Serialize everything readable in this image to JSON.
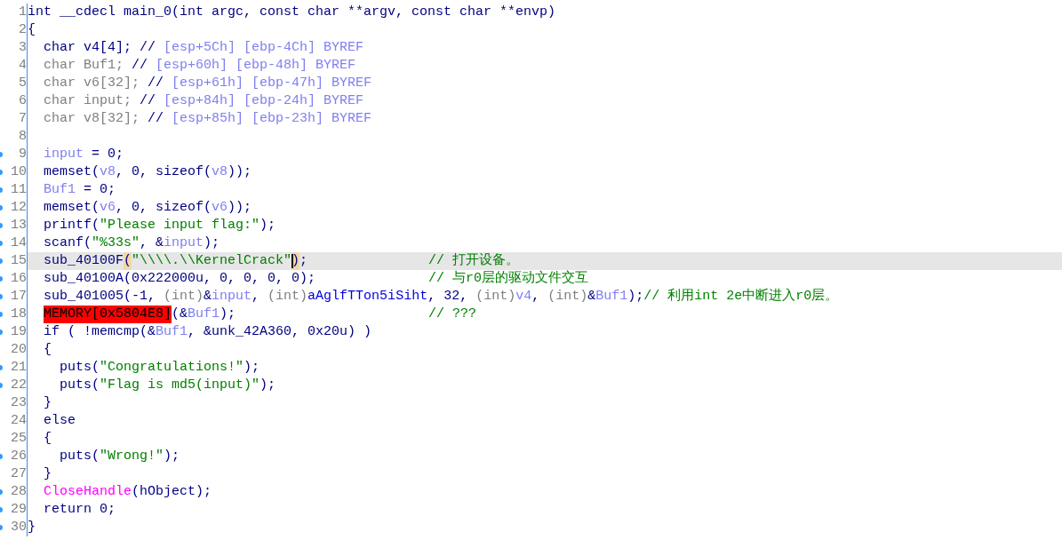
{
  "lines": [
    {
      "number": "1",
      "dot": false,
      "selected": false,
      "tokens": [
        {
          "text": "int __cdecl main_0(int argc, const char **argv, const char **envp)",
          "kind": "plain"
        }
      ]
    },
    {
      "number": "2",
      "dot": false,
      "selected": false,
      "tokens": [
        {
          "text": "{",
          "kind": "plain"
        }
      ],
      "children": [
        {
          "number": "3",
          "dot": false,
          "selected": false,
          "tokens": [
            {
              "text": "char v4[4]; //",
              "kind": "plain"
            },
            {
              "text": " [esp+5Ch] [ebp-4Ch] BYREF",
              "kind": "var"
            }
          ]
        },
        {
          "number": "4",
          "dot": false,
          "selected": false,
          "tokens": [
            {
              "text": "char Buf1;",
              "kind": "grey"
            },
            {
              "text": " //",
              "kind": "plain"
            },
            {
              "text": " [esp+60h] [ebp-48h] BYREF",
              "kind": "var"
            }
          ]
        },
        {
          "number": "5",
          "dot": false,
          "selected": false,
          "tokens": [
            {
              "text": "char v6[32];",
              "kind": "grey"
            },
            {
              "text": " //",
              "kind": "plain"
            },
            {
              "text": " [esp+61h] [ebp-47h] BYREF",
              "kind": "var"
            }
          ]
        },
        {
          "number": "6",
          "dot": false,
          "selected": false,
          "tokens": [
            {
              "text": "char input;",
              "kind": "grey"
            },
            {
              "text": " //",
              "kind": "plain"
            },
            {
              "text": " [esp+84h] [ebp-24h] BYREF",
              "kind": "var"
            }
          ]
        },
        {
          "number": "7",
          "dot": false,
          "selected": false,
          "tokens": [
            {
              "text": "char v8[32];",
              "kind": "grey"
            },
            {
              "text": " //",
              "kind": "plain"
            },
            {
              "text": " [esp+85h] [ebp-23h] BYREF",
              "kind": "var"
            }
          ]
        },
        {
          "number": "8",
          "dot": false,
          "selected": false
        },
        {
          "number": "9",
          "dot": true,
          "selected": false,
          "tokens": [
            {
              "text": "input",
              "kind": "var"
            },
            {
              "text": " = 0;",
              "kind": "plain"
            }
          ]
        },
        {
          "number": "10",
          "dot": true,
          "selected": false,
          "tokens": [
            {
              "text": "memset(",
              "kind": "plain"
            },
            {
              "text": "v8",
              "kind": "var"
            },
            {
              "text": ", 0, sizeof(",
              "kind": "plain"
            },
            {
              "text": "v8",
              "kind": "var"
            },
            {
              "text": "));",
              "kind": "plain"
            }
          ]
        },
        {
          "number": "11",
          "dot": true,
          "selected": false,
          "tokens": [
            {
              "text": "Buf1",
              "kind": "var"
            },
            {
              "text": " = 0;",
              "kind": "plain"
            }
          ]
        },
        {
          "number": "12",
          "dot": true,
          "selected": false,
          "tokens": [
            {
              "text": "memset(",
              "kind": "plain"
            },
            {
              "text": "v6",
              "kind": "var"
            },
            {
              "text": ", 0, sizeof(",
              "kind": "plain"
            },
            {
              "text": "v6",
              "kind": "var"
            },
            {
              "text": "));",
              "kind": "plain"
            }
          ]
        },
        {
          "number": "13",
          "dot": true,
          "selected": false,
          "tokens": [
            {
              "text": "printf(",
              "kind": "plain"
            },
            {
              "text": "\"Please input flag:\"",
              "kind": "string"
            },
            {
              "text": ");",
              "kind": "plain"
            }
          ]
        },
        {
          "number": "14",
          "dot": true,
          "selected": false,
          "tokens": [
            {
              "text": "scanf(",
              "kind": "plain"
            },
            {
              "text": "\"%33s\"",
              "kind": "string"
            },
            {
              "text": ", &",
              "kind": "plain"
            },
            {
              "text": "input",
              "kind": "var"
            },
            {
              "text": ");",
              "kind": "plain"
            }
          ]
        },
        {
          "number": "15",
          "dot": true,
          "selected": true,
          "tokens": [
            {
              "text": "sub_40100F",
              "kind": "plain"
            },
            {
              "text": "(",
              "kind": "paren_match"
            },
            {
              "text": "\"\\\\\\\\.\\\\KernelCrack\"",
              "kind": "string"
            },
            {
              "text": ")",
              "kind": "paren_match",
              "cursor": true
            },
            {
              "text": ";",
              "kind": "plain"
            }
          ],
          "comment": "// 打开设备。"
        },
        {
          "number": "16",
          "dot": true,
          "selected": false,
          "tokens": [
            {
              "text": "sub_40100A(0x222000u, 0, 0, 0, 0);",
              "kind": "plain"
            }
          ],
          "comment": "// 与r0层的驱动文件交互"
        },
        {
          "number": "17",
          "dot": true,
          "selected": false,
          "tokens": [
            {
              "text": "sub_401005(-1, ",
              "kind": "plain"
            },
            {
              "text": "(int)",
              "kind": "grey"
            },
            {
              "text": "&",
              "kind": "plain"
            },
            {
              "text": "input",
              "kind": "var"
            },
            {
              "text": ", ",
              "kind": "plain"
            },
            {
              "text": "(int)",
              "kind": "grey"
            },
            {
              "text": "aAglfTTon5iSiht",
              "kind": "global"
            },
            {
              "text": ", 32, ",
              "kind": "plain"
            },
            {
              "text": "(int)",
              "kind": "grey"
            },
            {
              "text": "v4",
              "kind": "var"
            },
            {
              "text": ", ",
              "kind": "plain"
            },
            {
              "text": "(int)",
              "kind": "grey"
            },
            {
              "text": "&",
              "kind": "plain"
            },
            {
              "text": "Buf1",
              "kind": "var"
            },
            {
              "text": ");",
              "kind": "plain"
            }
          ],
          "comment": "// 利用int 2e中断进入r0层。"
        },
        {
          "number": "18",
          "dot": true,
          "selected": false,
          "tokens": [
            {
              "text": "MEMORY[0x5804E8]",
              "kind": "error"
            },
            {
              "text": "(&",
              "kind": "plain"
            },
            {
              "text": "Buf1",
              "kind": "var"
            },
            {
              "text": ");",
              "kind": "plain"
            }
          ],
          "comment": "// ???"
        },
        {
          "number": "19",
          "dot": true,
          "selected": false,
          "tokens": [
            {
              "text": "if ( !memcmp(&",
              "kind": "plain"
            },
            {
              "text": "Buf1",
              "kind": "var"
            },
            {
              "text": ", &unk_42A360, 0x20u) )",
              "kind": "plain"
            }
          ]
        },
        {
          "number": "20",
          "dot": false,
          "selected": false,
          "tokens": [
            {
              "text": "{",
              "kind": "plain"
            }
          ],
          "children": [
            {
              "number": "21",
              "dot": true,
              "selected": false,
              "tokens": [
                {
                  "text": "puts(",
                  "kind": "plain"
                },
                {
                  "text": "\"Congratulations!\"",
                  "kind": "string"
                },
                {
                  "text": ");",
                  "kind": "plain"
                }
              ]
            },
            {
              "number": "22",
              "dot": true,
              "selected": false,
              "tokens": [
                {
                  "text": "puts(",
                  "kind": "plain"
                },
                {
                  "text": "\"Flag is md5(input)\"",
                  "kind": "string"
                },
                {
                  "text": ");",
                  "kind": "plain"
                }
              ]
            }
          ]
        },
        {
          "number": "23",
          "dot": false,
          "selected": false,
          "tokens": [
            {
              "text": "}",
              "kind": "plain"
            }
          ]
        },
        {
          "number": "24",
          "dot": false,
          "selected": false,
          "tokens": [
            {
              "text": "else",
              "kind": "plain"
            }
          ]
        },
        {
          "number": "25",
          "dot": false,
          "selected": false,
          "tokens": [
            {
              "text": "{",
              "kind": "plain"
            }
          ],
          "children": [
            {
              "number": "26",
              "dot": true,
              "selected": false,
              "tokens": [
                {
                  "text": "puts(",
                  "kind": "plain"
                },
                {
                  "text": "\"Wrong!\"",
                  "kind": "string"
                },
                {
                  "text": ");",
                  "kind": "plain"
                }
              ]
            }
          ]
        },
        {
          "number": "27",
          "dot": false,
          "selected": false,
          "tokens": [
            {
              "text": "}",
              "kind": "plain"
            }
          ]
        },
        {
          "number": "28",
          "dot": true,
          "selected": false,
          "tokens": [
            {
              "text": "CloseHandle",
              "kind": "import"
            },
            {
              "text": "(hObject);",
              "kind": "plain"
            }
          ]
        },
        {
          "number": "29",
          "dot": true,
          "selected": false,
          "tokens": [
            {
              "text": "return 0;",
              "kind": "plain"
            }
          ]
        }
      ]
    },
    {
      "number": "30",
      "dot": true,
      "selected": false,
      "tokens": [
        {
          "text": "}",
          "kind": "plain"
        }
      ]
    }
  ]
}
